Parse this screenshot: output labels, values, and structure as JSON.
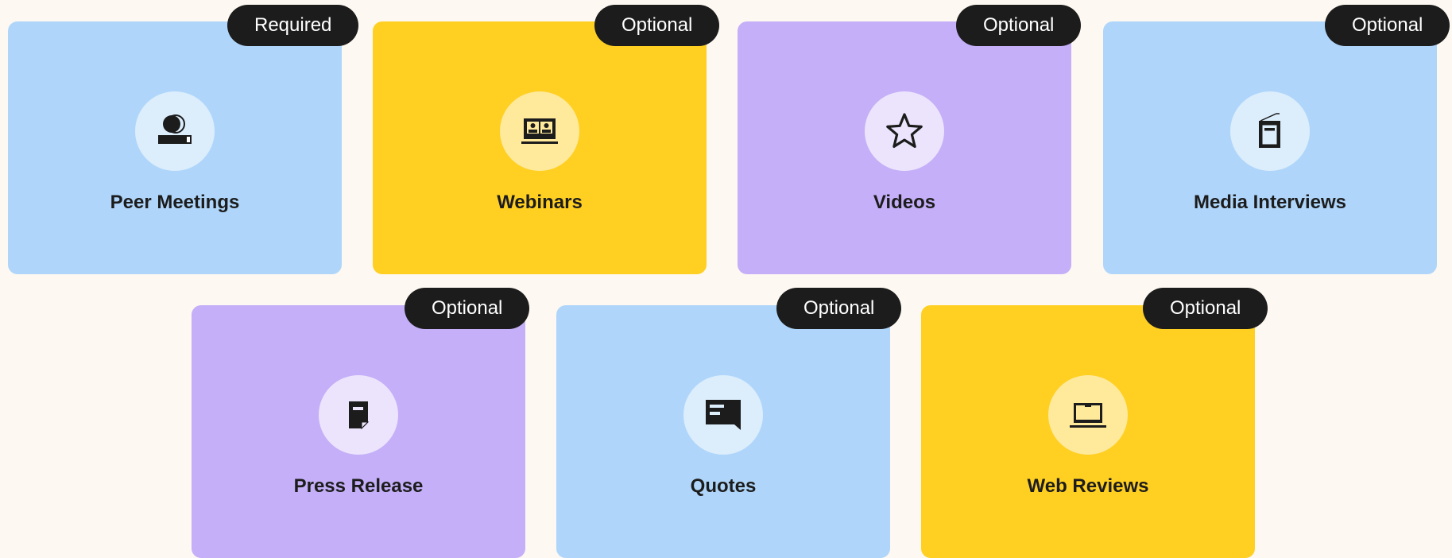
{
  "cards": [
    {
      "label": "Peer Meetings",
      "badge": "Required",
      "icon": "video-conference-icon",
      "color": "#AFD6FA"
    },
    {
      "label": "Webinars",
      "badge": "Optional",
      "icon": "webinar-laptop-icon",
      "color": "#FFCF22"
    },
    {
      "label": "Videos",
      "badge": "Optional",
      "icon": "star-icon",
      "color": "#C4AFF8"
    },
    {
      "label": "Media Interviews",
      "badge": "Optional",
      "icon": "booklet-icon",
      "color": "#AFD6FA"
    },
    {
      "label": "Press Release",
      "badge": "Optional",
      "icon": "document-icon",
      "color": "#C4AFF8"
    },
    {
      "label": "Quotes",
      "badge": "Optional",
      "icon": "speech-bubble-icon",
      "color": "#AFD6FA"
    },
    {
      "label": "Web Reviews",
      "badge": "Optional",
      "icon": "laptop-icon",
      "color": "#FFCF22"
    }
  ]
}
